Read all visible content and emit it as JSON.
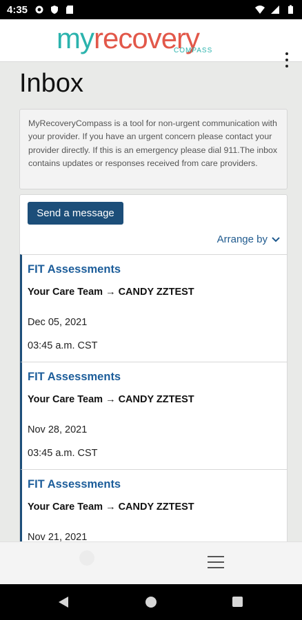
{
  "status_bar": {
    "time": "4:35"
  },
  "header": {
    "logo_my": "my",
    "logo_recovery": "recovery",
    "logo_sub": "COMPASS"
  },
  "page": {
    "title": "Inbox",
    "notice": "MyRecoveryCompass is a tool for non-urgent communication with your provider. If you have an urgent concern please contact your provider directly.  If this is an emergency please dial 911.The inbox contains updates or responses received from care providers."
  },
  "actions": {
    "send_label": "Send a message",
    "arrange_label": "Arrange by"
  },
  "messages": [
    {
      "subject": "FIT Assessments",
      "from": "Your Care Team",
      "arrow": "→",
      "to": "CANDY ZZTEST",
      "date": "Dec 05, 2021",
      "time": "03:45 a.m. CST"
    },
    {
      "subject": "FIT Assessments",
      "from": "Your Care Team",
      "arrow": "→",
      "to": "CANDY ZZTEST",
      "date": "Nov 28, 2021",
      "time": "03:45 a.m. CST"
    },
    {
      "subject": "FIT Assessments",
      "from": "Your Care Team",
      "arrow": "→",
      "to": "CANDY ZZTEST",
      "date": "Nov 21, 2021",
      "time": ""
    }
  ],
  "icons": {
    "kebab": "more-vert-icon",
    "chevron": "chevron-down-icon",
    "menu": "menu-icon"
  },
  "colors": {
    "brand_teal": "#2bb3ad",
    "brand_coral": "#e2584a",
    "primary_blue": "#1c4e79",
    "link_blue": "#1c5d9a"
  }
}
